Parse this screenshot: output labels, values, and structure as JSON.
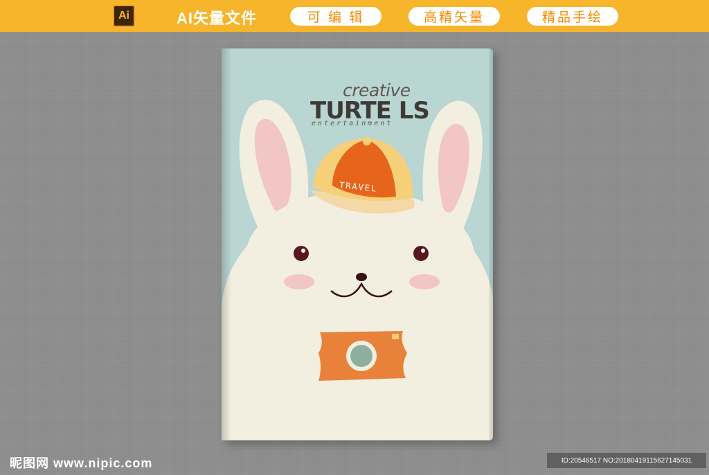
{
  "banner": {
    "ai_label": "Ai",
    "title": "AI矢量文件",
    "pills": [
      "可 编 辑",
      "高精矢量",
      "精品手绘"
    ]
  },
  "cover": {
    "logo_top": "creative",
    "logo_main": "TURTE LS",
    "logo_sub": "entertainment",
    "hat_text": "TRAVEL"
  },
  "watermark": {
    "site": "昵图网 www.nipic.com",
    "id_text": "ID:20546517 NO:20180419115627145031"
  },
  "colors": {
    "banner": "#f7b52c",
    "cover_sky": "#b9d6d3",
    "rabbit": "#f2efe0",
    "ear_inner": "#f1c6c5",
    "hat_orange": "#e7651a",
    "hat_yellow": "#f6cf79",
    "camera": "#e8823a"
  }
}
